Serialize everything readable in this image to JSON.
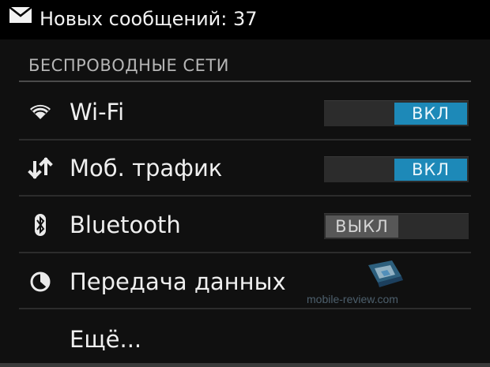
{
  "status_bar": {
    "icon": "mail-icon",
    "text": "Новых сообщений: 37"
  },
  "section": {
    "header": "БЕСПРОВОДНЫЕ СЕТИ"
  },
  "rows": [
    {
      "icon": "wifi-icon",
      "label": "Wi-Fi",
      "toggle": "ВКЛ",
      "state": "on"
    },
    {
      "icon": "mobile-data-icon",
      "label": "Моб. трафик",
      "toggle": "ВКЛ",
      "state": "on"
    },
    {
      "icon": "bluetooth-icon",
      "label": "Bluetooth",
      "toggle": "ВЫКЛ",
      "state": "off"
    },
    {
      "icon": "data-usage-icon",
      "label": "Передача данных"
    },
    {
      "label": "Ещё..."
    }
  ],
  "watermark": {
    "text": "mobile-review.com"
  },
  "colors": {
    "toggle_on": "#1d89b8",
    "toggle_off": "#575757",
    "background": "#101010"
  }
}
